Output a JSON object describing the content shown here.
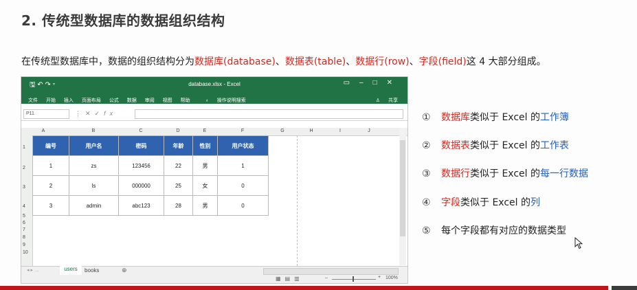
{
  "title": "2. 传统型数据库的数据组织结构",
  "intro": {
    "prefix": "在传统型数据库中，数据的组织结构分为",
    "t1": "数据库(database)",
    "sep1": "、",
    "t2": "数据表(table)",
    "sep2": "、",
    "t3": "数据行(row)",
    "sep3": "、",
    "t4": "字段(field)",
    "suffix": "这 4 大部分组成。"
  },
  "excel": {
    "filename": "database.xlsx - Excel",
    "menu": [
      "文件",
      "开始",
      "插入",
      "页面布局",
      "公式",
      "数据",
      "审阅",
      "视图",
      "帮助",
      "操作说明搜索"
    ],
    "share": "共享",
    "name_box": "P11",
    "fx": "fx",
    "columns": [
      "A",
      "B",
      "C",
      "D",
      "E",
      "F",
      "G",
      "H",
      "I",
      "J"
    ],
    "rows": [
      "1",
      "2",
      "3",
      "4",
      "5",
      "6",
      "7",
      "8",
      "9",
      "10"
    ],
    "headers": [
      "编号",
      "用户名",
      "密码",
      "年龄",
      "性别",
      "用户状态"
    ],
    "data": [
      [
        "1",
        "zs",
        "123456",
        "22",
        "男",
        "1"
      ],
      [
        "2",
        "ls",
        "000000",
        "25",
        "女",
        "0"
      ],
      [
        "3",
        "admin",
        "abc123",
        "28",
        "男",
        "0"
      ]
    ],
    "sheets": [
      "users",
      "books"
    ],
    "zoom": "100%",
    "colors": {
      "ribbon": "#217346",
      "header_fill": "#2f63b0"
    }
  },
  "notes": [
    {
      "num": "①",
      "a": "数据库",
      "b": "类似于 Excel 的",
      "c": "工作簿"
    },
    {
      "num": "②",
      "a": "数据表",
      "b": "类似于 Excel 的",
      "c": "工作表"
    },
    {
      "num": "③",
      "a": "数据行",
      "b": "类似于 Excel 的",
      "c": "每一行数据"
    },
    {
      "num": "④",
      "a": "字段",
      "b": "类似于 Excel 的",
      "c": "列"
    },
    {
      "num": "⑤",
      "a": "",
      "b": "每个字段都有对应的数据类型",
      "c": ""
    }
  ]
}
